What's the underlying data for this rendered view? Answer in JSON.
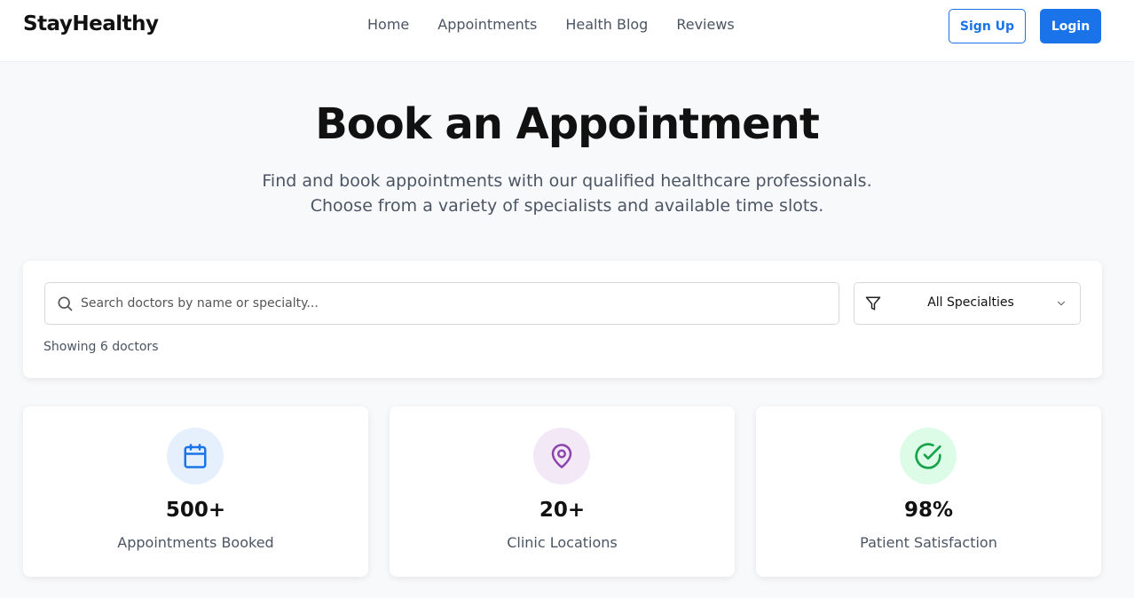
{
  "navbar": {
    "brand": "StayHealthy",
    "links": [
      "Home",
      "Appointments",
      "Health Blog",
      "Reviews"
    ],
    "signup_label": "Sign Up",
    "login_label": "Login"
  },
  "hero": {
    "title": "Book an Appointment",
    "subtitle_line1": "Find and book appointments with our qualified healthcare professionals.",
    "subtitle_line2": "Choose from a variety of specialists and available time slots."
  },
  "search": {
    "placeholder": "Search doctors by name or specialty...",
    "value": "",
    "filter_selected": "All Specialties",
    "result_count": "Showing 6 doctors"
  },
  "stats": [
    {
      "value": "500+",
      "label": "Appointments Booked",
      "icon": "calendar-icon",
      "icon_color": "#1a73e8",
      "bg_color": "#e6f0fd"
    },
    {
      "value": "20+",
      "label": "Clinic Locations",
      "icon": "map-pin-icon",
      "icon_color": "#8e44ad",
      "bg_color": "#f3e8f6"
    },
    {
      "value": "98%",
      "label": "Patient Satisfaction",
      "icon": "check-circle-icon",
      "icon_color": "#16a34a",
      "bg_color": "#dcfce7"
    }
  ],
  "colors": {
    "primary": "#1a73e8",
    "background": "#f8f9fb",
    "text_muted": "#4b5563"
  }
}
